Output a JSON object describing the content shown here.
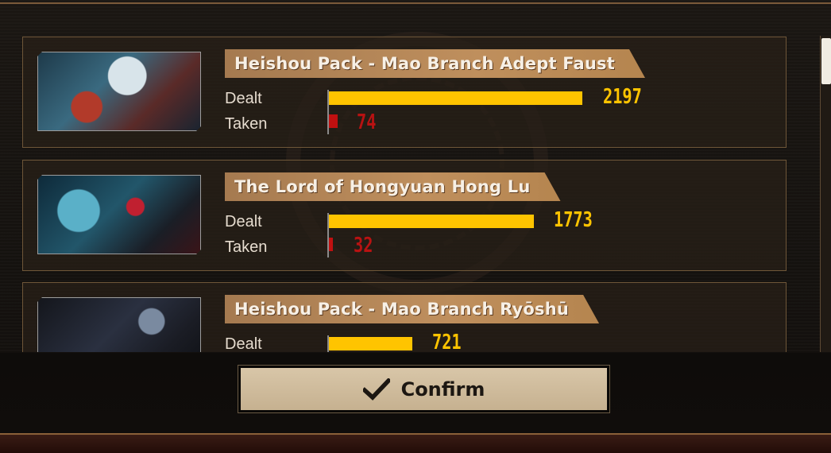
{
  "results": [
    {
      "name": "Heishou Pack - Mao Branch Adept Faust",
      "dealt_label": "Dealt",
      "dealt": "2197",
      "taken_label": "Taken",
      "taken": "74"
    },
    {
      "name": "The Lord of Hongyuan Hong Lu",
      "dealt_label": "Dealt",
      "dealt": "1773",
      "taken_label": "Taken",
      "taken": "32"
    },
    {
      "name": "Heishou Pack - Mao Branch Ryōshū",
      "dealt_label": "Dealt",
      "dealt": "721"
    }
  ],
  "confirm_button": {
    "label": "Confirm",
    "icon": "checkmark-icon"
  },
  "colors": {
    "dealt_bar": "#ffc400",
    "taken_bar": "#c01010",
    "name_plate": "#b5854f"
  }
}
